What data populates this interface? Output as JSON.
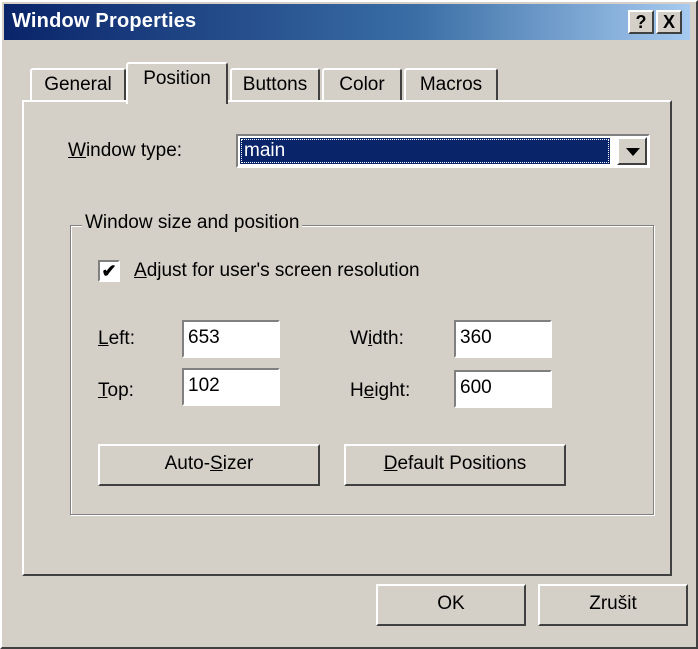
{
  "window": {
    "title": "Window Properties",
    "help_label": "?",
    "close_label": "X"
  },
  "tabs": [
    {
      "label": "General"
    },
    {
      "label": "Position"
    },
    {
      "label": "Buttons"
    },
    {
      "label": "Color"
    },
    {
      "label": "Macros"
    }
  ],
  "window_type": {
    "label_prefix": "",
    "label_key": "W",
    "label_rest": "indow type:",
    "value": "main"
  },
  "size_group": {
    "title": "Window size and position",
    "adjust_checkbox": {
      "checked_mark": "✔",
      "label_key": "A",
      "label_rest": "djust for user's screen resolution"
    },
    "left": {
      "label_key": "L",
      "label_rest": "eft:",
      "value": "653"
    },
    "top": {
      "label_key": "T",
      "label_rest": "op:",
      "value": "102"
    },
    "width": {
      "label_pre": "W",
      "label_key": "i",
      "label_rest": "dth:",
      "value": "360"
    },
    "height": {
      "label_pre": "H",
      "label_key": "e",
      "label_rest": "ight:",
      "value": "600"
    },
    "auto_sizer": {
      "label_pre": "Auto-",
      "label_key": "S",
      "label_rest": "izer"
    },
    "default_positions": {
      "label_key": "D",
      "label_rest": "efault Positions"
    }
  },
  "footer": {
    "ok_label": "OK",
    "cancel_label": "Zrušit"
  }
}
